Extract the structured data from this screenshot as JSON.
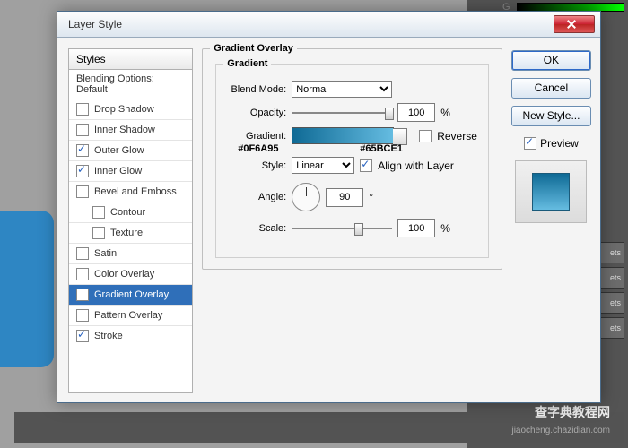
{
  "titlebar": {
    "title": "Layer Style"
  },
  "styles_header": "Styles",
  "blending_options": "Blending Options: Default",
  "styles": {
    "drop_shadow": "Drop Shadow",
    "inner_shadow": "Inner Shadow",
    "outer_glow": "Outer Glow",
    "inner_glow": "Inner Glow",
    "bevel_emboss": "Bevel and Emboss",
    "contour": "Contour",
    "texture": "Texture",
    "satin": "Satin",
    "color_overlay": "Color Overlay",
    "gradient_overlay": "Gradient Overlay",
    "pattern_overlay": "Pattern Overlay",
    "stroke": "Stroke"
  },
  "group": {
    "outer": "Gradient Overlay",
    "inner": "Gradient",
    "blend_mode_label": "Blend Mode:",
    "blend_mode_value": "Normal",
    "opacity_label": "Opacity:",
    "opacity_value": "100",
    "percent": "%",
    "gradient_label": "Gradient:",
    "reverse_label": "Reverse",
    "style_label": "Style:",
    "style_value": "Linear",
    "align_label": "Align with Layer",
    "angle_label": "Angle:",
    "angle_value": "90",
    "degree": "°",
    "scale_label": "Scale:",
    "scale_value": "100",
    "color1": "#0F6A95",
    "color2": "#65BCE1"
  },
  "buttons": {
    "ok": "OK",
    "cancel": "Cancel",
    "new_style": "New Style...",
    "preview": "Preview"
  },
  "bg": {
    "g": "G",
    "watermark": "查字典教程网",
    "sub": "jiaocheng.chazidian.com",
    "side": "ets"
  }
}
